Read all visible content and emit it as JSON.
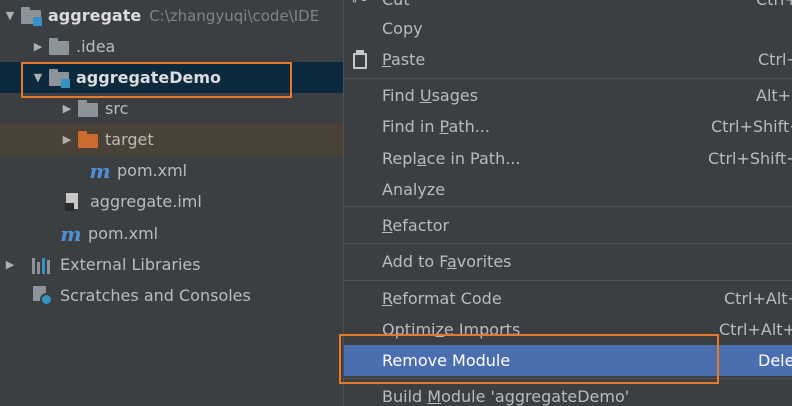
{
  "tree": {
    "root": {
      "label": "aggregate",
      "path": "C:\\zhangyuqi\\code\\IDE"
    },
    "idea": "idea",
    "module": "aggregateDemo",
    "src": "src",
    "target": "target",
    "module_pom": "pom.xml",
    "iml": "aggregate.iml",
    "root_pom": "pom.xml",
    "ext_libs": "External Libraries",
    "scratches": "Scratches and Consoles",
    "maven_glyph": "m",
    "icons": {
      "folder": "folder-icon",
      "module": "module-folder-icon",
      "maven": "maven-icon",
      "iml": "iml-file-icon",
      "libraries": "libraries-icon",
      "scratches": "scratches-icon"
    }
  },
  "menu": {
    "cut": {
      "label": "Cut",
      "shortcut": "Ctrl+X"
    },
    "copy": {
      "label": "Copy"
    },
    "paste": {
      "label_pre": "",
      "label_u": "P",
      "label_post": "aste",
      "shortcut": "Ctrl+"
    },
    "find_usages": {
      "label_pre": "Find ",
      "label_u": "U",
      "label_post": "sages",
      "shortcut": "Alt+"
    },
    "find_in_path": {
      "label_pre": "Find in ",
      "label_u": "P",
      "label_post": "ath...",
      "shortcut": "Ctrl+Shift+"
    },
    "replace_in_path": {
      "label_pre": "Repl",
      "label_u": "a",
      "label_post": "ce in Path...",
      "shortcut": "Ctrl+Shift+"
    },
    "analyze": {
      "label": "Analyze"
    },
    "refactor": {
      "label_pre": "",
      "label_u": "R",
      "label_post": "efactor"
    },
    "add_favorites": {
      "label_pre": "Add to F",
      "label_u": "a",
      "label_post": "vorites"
    },
    "reformat": {
      "label_pre": "",
      "label_u": "R",
      "label_post": "eformat Code",
      "shortcut": "Ctrl+Alt+"
    },
    "optimize": {
      "label_pre": "Optimi",
      "label_u": "z",
      "label_post": "e Imports",
      "shortcut": "Ctrl+Alt+"
    },
    "remove_module": {
      "label": "Remove Module",
      "shortcut": "Dele"
    },
    "build_module": {
      "label_pre": "Build ",
      "label_u": "M",
      "label_post": "odule 'aggregateDemo'"
    }
  },
  "colors": {
    "highlight_box": "#e8792b",
    "menu_active": "#4b6eaf",
    "tree_selected": "#0d293e",
    "excluded_folder": "#cc6a2f"
  }
}
